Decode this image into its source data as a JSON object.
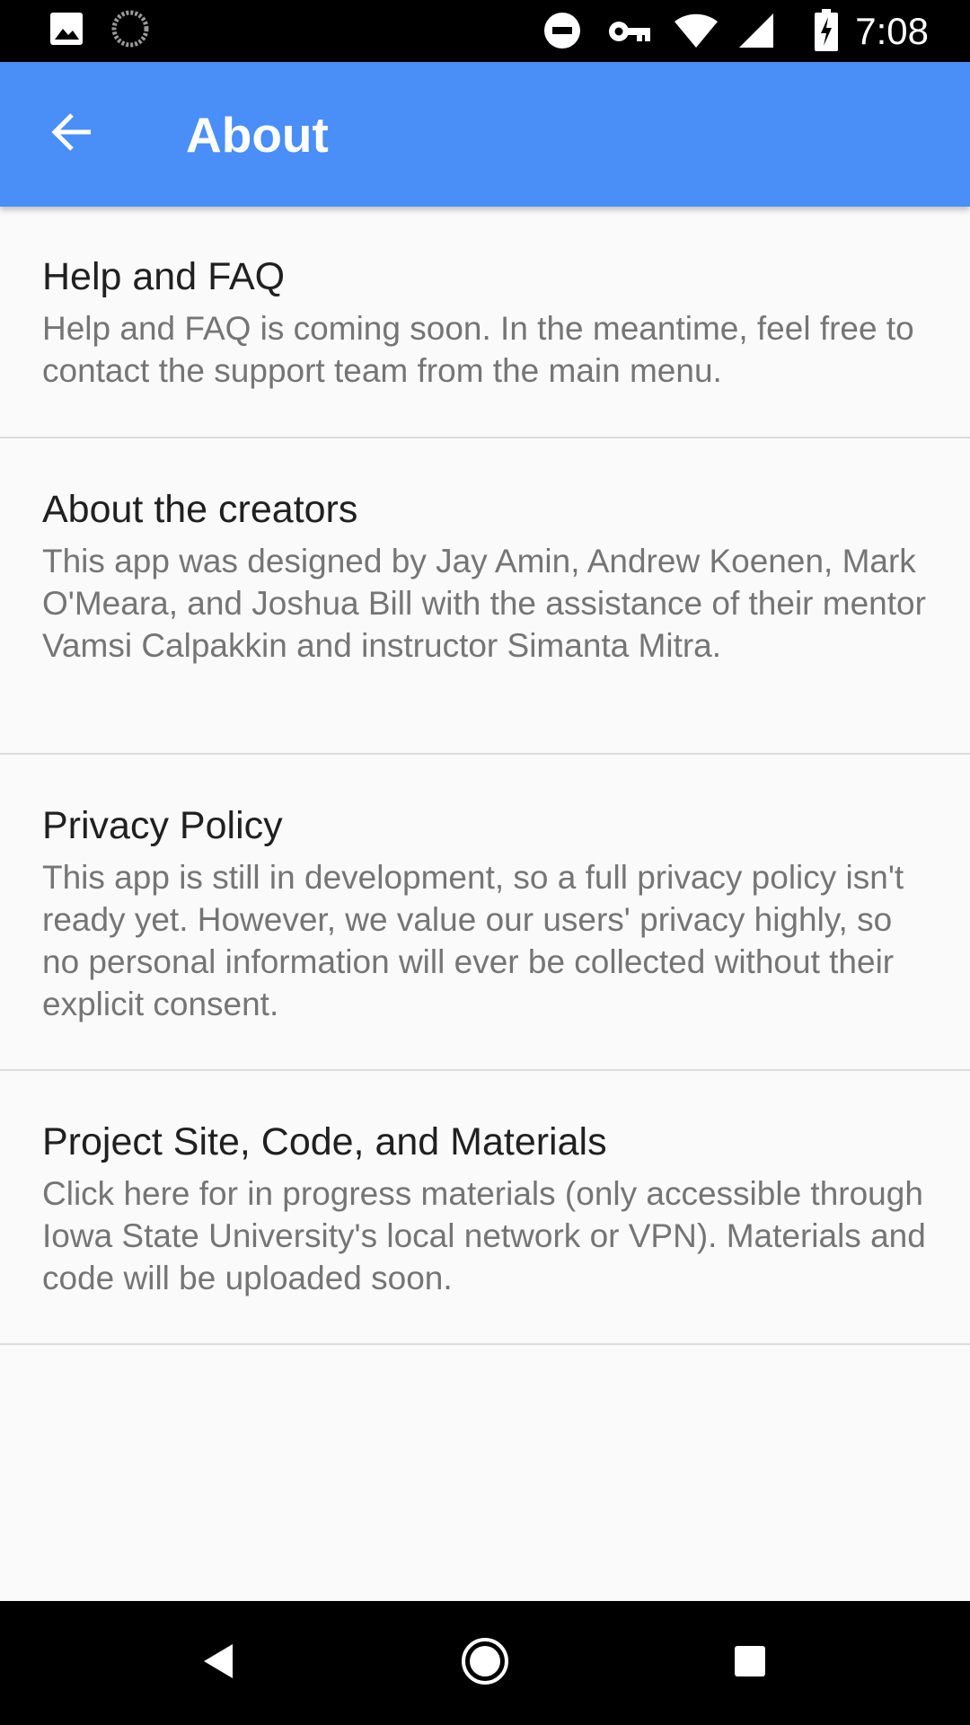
{
  "status_bar": {
    "time": "7:08",
    "left_icons": [
      "image-notification-icon",
      "loading-spinner-icon"
    ],
    "right_icons": [
      "do-not-disturb-icon",
      "vpn-key-icon",
      "wifi-icon",
      "cell-signal-icon",
      "battery-charging-icon"
    ]
  },
  "app_bar": {
    "title": "About",
    "back_icon": "arrow-back-icon",
    "color": "#4a8ef8"
  },
  "sections": [
    {
      "title": "Help and FAQ",
      "body": "Help and FAQ is coming soon. In the meantime, feel free to contact the support team from the main menu."
    },
    {
      "title": "About the creators",
      "body": "This app was designed by Jay Amin, Andrew Koenen, Mark O'Meara, and Joshua Bill with the assistance of their mentor Vamsi Calpakkin and instructor Simanta Mitra."
    },
    {
      "title": "Privacy Policy",
      "body": "This app is still in development, so a full privacy policy isn't ready yet. However, we value our users' privacy highly, so no personal information will ever be collected without their explicit consent."
    },
    {
      "title": "Project Site, Code, and Materials",
      "body": "Click here for in progress materials (only accessible through Iowa State University's local network or VPN). Materials and code will be uploaded soon."
    }
  ],
  "nav_bar": {
    "buttons": [
      "nav-back-icon",
      "nav-home-icon",
      "nav-recents-icon"
    ]
  }
}
